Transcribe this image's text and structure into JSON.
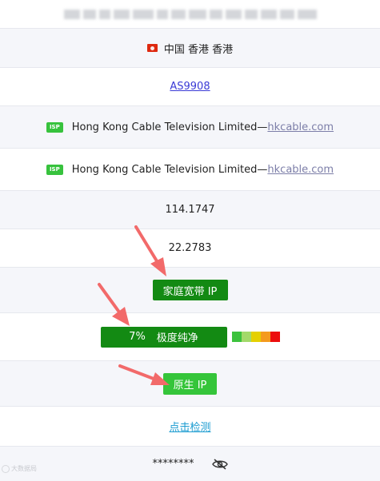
{
  "location": {
    "flag": "hong-kong-flag",
    "text": "中国 香港 香港"
  },
  "asn": {
    "text": "AS9908"
  },
  "isp_rows": [
    {
      "badge": "ISP",
      "name": "Hong Kong Cable Television Limited—",
      "domain": "hkcable.com"
    },
    {
      "badge": "ISP",
      "name": "Hong Kong Cable Television Limited—",
      "domain": "hkcable.com"
    }
  ],
  "longitude": "114.1747",
  "latitude": "22.2783",
  "ip_type": {
    "label": "家庭宽带 IP",
    "color": "#138a13"
  },
  "purity": {
    "percent": "7%",
    "label": "极度纯净",
    "color": "#138a13",
    "scale_colors": [
      "#3cc23d",
      "#a3d96a",
      "#e5d000",
      "#f49a1e",
      "#ec0d0d"
    ]
  },
  "origin": {
    "label": "原生 IP",
    "color": "#35c53a"
  },
  "detect": {
    "text": "点击检测"
  },
  "hidden": {
    "mask": "********",
    "icon": "eye-off-icon"
  },
  "colors": {
    "row_alt": "#f5f6fa",
    "border": "#e6e8ee",
    "link": "#3a3ad6",
    "arrow": "#f26a6a"
  }
}
